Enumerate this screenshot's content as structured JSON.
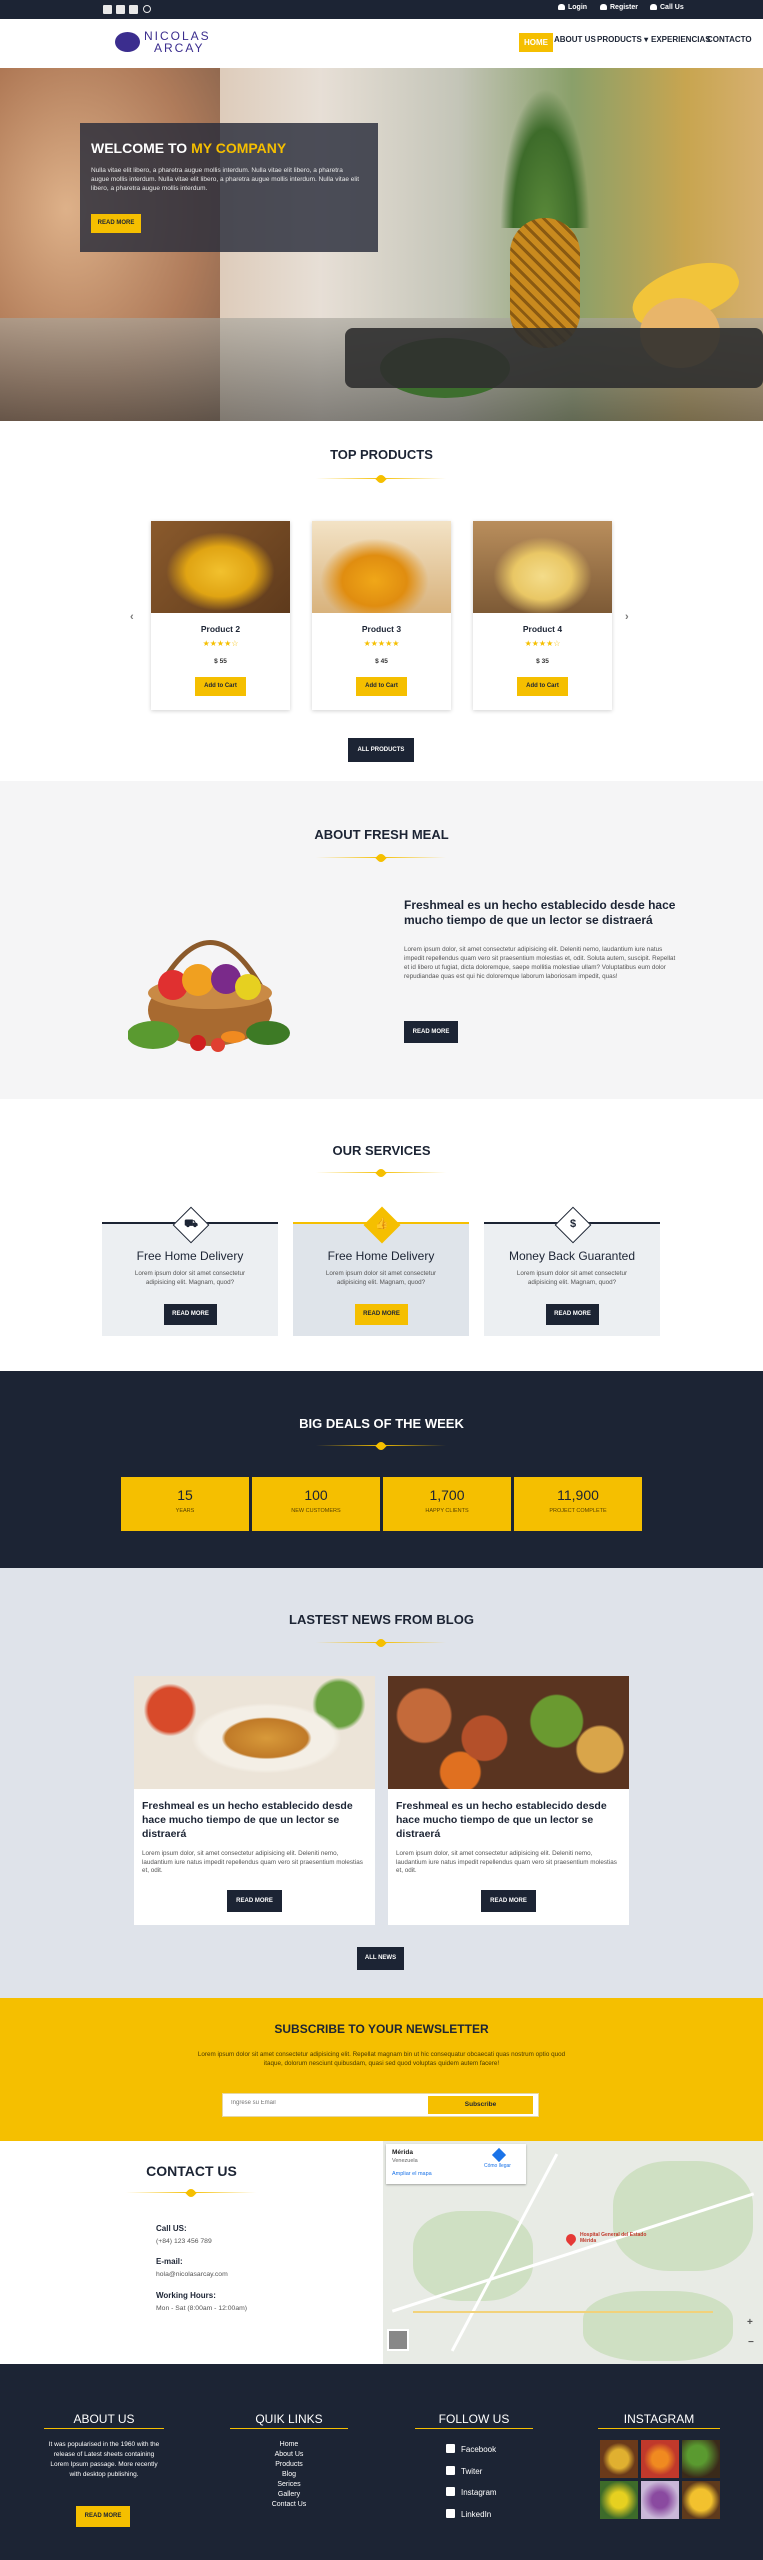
{
  "colors": {
    "navy": "#1c2434",
    "accent": "#f5bf00"
  },
  "topbar": {
    "social_icons": [
      "facebook-icon",
      "twitter-icon",
      "instagram-icon",
      "search-icon"
    ],
    "login": "Login",
    "register": "Register",
    "call": "Call Us"
  },
  "header": {
    "logo_line1": "NICOLAS",
    "logo_line2": "ARCAY",
    "nav": [
      "HOME",
      "ABOUT US",
      "PRODUCTS",
      "EXPERIENCIAS",
      "CONTACTO"
    ]
  },
  "hero": {
    "title_plain": "WELCOME TO ",
    "title_highlight": "MY COMPANY",
    "text": "Nulla vitae elit libero, a pharetra augue mollis interdum. Nulla vitae elit libero, a pharetra augue mollis interdum. Nulla vitae elit libero, a pharetra augue mollis interdum. Nulla vitae elit libero, a pharetra augue mollis interdum.",
    "button": "READ MORE"
  },
  "products": {
    "title": "TOP PRODUCTS",
    "items": [
      {
        "name": "Product 2",
        "stars": "★★★★☆",
        "rating": 4,
        "price": "$ 55",
        "button": "Add to Cart"
      },
      {
        "name": "Product 3",
        "stars": "★★★★★",
        "rating": 5,
        "price": "$ 45",
        "button": "Add to Cart"
      },
      {
        "name": "Product 4",
        "stars": "★★★★☆",
        "rating": 4,
        "price": "$ 35",
        "button": "Add to Cart"
      }
    ],
    "prev": "‹",
    "next": "›",
    "all_button": "ALL PRODUCTS"
  },
  "about": {
    "title": "ABOUT FRESH MEAL",
    "heading": "Freshmeal es un hecho establecido desde hace mucho tiempo de que un lector se distraerá",
    "text": "Lorem ipsum dolor, sit amet consectetur adipisicing elit. Deleniti nemo, laudantium iure natus impedit repellendus quam vero sit praesentium molestias et, odit. Soluta autem, suscipit. Repellat et id libero ut fugiat, dicta doloremque, saepe mollitia molestiae ullam? Voluptatibus eum dolor repudiandae quas est qui hic doloremque laborum laboriosam impedit, quas!",
    "button": "READ MORE"
  },
  "services": {
    "title": "OUR SERVICES",
    "items": [
      {
        "icon": "delivery-truck-icon",
        "glyph": "⛟",
        "title": "Free Home Delivery",
        "text": "Lorem ipsum dolor sit amet consectetur adipisicing elit. Magnam, quod?",
        "button": "READ MORE"
      },
      {
        "icon": "thumbs-up-icon",
        "glyph": "👍",
        "title": "Free Home Delivery",
        "text": "Lorem ipsum dolor sit amet consectetur adipisicing elit. Magnam, quod?",
        "button": "READ MORE"
      },
      {
        "icon": "dollar-icon",
        "glyph": "$",
        "title": "Money Back Guaranted",
        "text": "Lorem ipsum dolor sit amet consectetur adipisicing elit. Magnam, quod?",
        "button": "READ MORE"
      }
    ]
  },
  "deals": {
    "title": "BIG DEALS OF THE WEEK",
    "items": [
      {
        "number": "15",
        "label": "YEARS"
      },
      {
        "number": "100",
        "label": "NEW CUSTOMERS"
      },
      {
        "number": "1,700",
        "label": "HAPPY CLIENTS"
      },
      {
        "number": "11,900",
        "label": "PROJECT COMPLETE"
      }
    ]
  },
  "news": {
    "title": "LASTEST NEWS FROM BLOG",
    "items": [
      {
        "title": "Freshmeal es un hecho establecido desde hace mucho tiempo de que un lector se distraerá",
        "text": "Lorem ipsum dolor, sit amet consectetur adipisicing elit. Deleniti nemo, laudantium iure natus impedit repellendus quam vero sit praesentium molestias et, odit.",
        "button": "READ MORE"
      },
      {
        "title": "Freshmeal es un hecho establecido desde hace mucho tiempo de que un lector se distraerá",
        "text": "Lorem ipsum dolor, sit amet consectetur adipisicing elit. Deleniti nemo, laudantium iure natus impedit repellendus quam vero sit praesentium molestias et, odit.",
        "button": "READ MORE"
      }
    ],
    "all_button": "ALL NEWS"
  },
  "newsletter": {
    "title": "SUBSCRIBE TO YOUR NEWSLETTER",
    "text": "Lorem ipsum dolor sit amet consectetur adipisicing elit. Repellat magnam bin ut hic consequatur obcaecati quas nostrum optio quod itaque, dolorum nesciunt quibusdam, quasi sed quod voluptas quidem autem facere!",
    "placeholder": "Ingrese su Email",
    "button": "Subscribe"
  },
  "contact": {
    "title": "CONTACT US",
    "call_label": "Call US:",
    "phone": "(+84) 123 456 789",
    "email_label": "E-mail:",
    "email": "hola@nicolasarcay.com",
    "hours_label": "Working Hours:",
    "hours": "Mon - Sat (8:00am - 12:00am)",
    "map_place": "Mérida",
    "map_sub": "Venezuela",
    "map_link": "Ampliar el mapa",
    "map_directions": "Cómo llegar",
    "map_marker": "Hospital General del Estado Mérida"
  },
  "footer": {
    "about_title": "ABOUT US",
    "about_text": "It was popularised in the 1960 with the release of Latest sheets containing Lorem Ipsum passage. More recently with desktop publishing.",
    "about_button": "READ MORE",
    "links_title": "QUIK LINKS",
    "links": [
      "Home",
      "About Us",
      "Products",
      "Blog",
      "Serices",
      "Gallery",
      "Contact Us"
    ],
    "follow_title": "FOLLOW US",
    "follow": [
      {
        "icon": "facebook-icon",
        "label": "Facebook"
      },
      {
        "icon": "twitter-icon",
        "label": "Twiter"
      },
      {
        "icon": "instagram-icon",
        "label": "Instagram"
      },
      {
        "icon": "linkedin-icon",
        "label": "LinkedIn"
      }
    ],
    "instagram_title": "INSTAGRAM"
  }
}
